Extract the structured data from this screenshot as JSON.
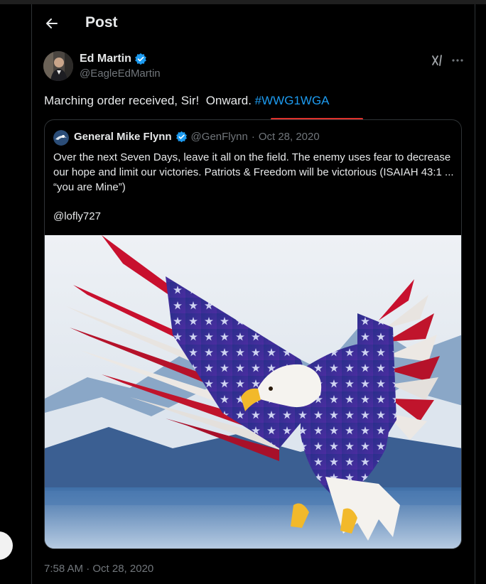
{
  "header": {
    "title": "Post"
  },
  "post": {
    "author_name": "Ed Martin",
    "author_handle": "@EagleEdMartin",
    "text_main": "Marching order received, Sir!  Onward. ",
    "hashtag": "#WWG1WGA",
    "timestamp": "7:58 AM · Oct 28, 2020"
  },
  "quote": {
    "author_name": "General Mike Flynn",
    "author_handle": "@GenFlynn",
    "separator": "·",
    "date": "Oct 28, 2020",
    "text": "Over the next Seven Days, leave it all on the field. The enemy uses fear to decrease our hope and limit our victories. Patriots & Freedom will be victorious (ISAIAH 43:1 ... “you are Mine”)",
    "mention": "@lofly727"
  },
  "icons": {
    "back": "arrow-left-icon",
    "verified": "verified-badge-icon",
    "grok": "grok-icon",
    "more": "more-icon"
  },
  "colors": {
    "background": "#000000",
    "text": "#e7e9ea",
    "muted": "#71767b",
    "link": "#1d9bf0",
    "verified": "#1d9bf0",
    "border": "#2f3336",
    "annotation": "#e0322d"
  }
}
